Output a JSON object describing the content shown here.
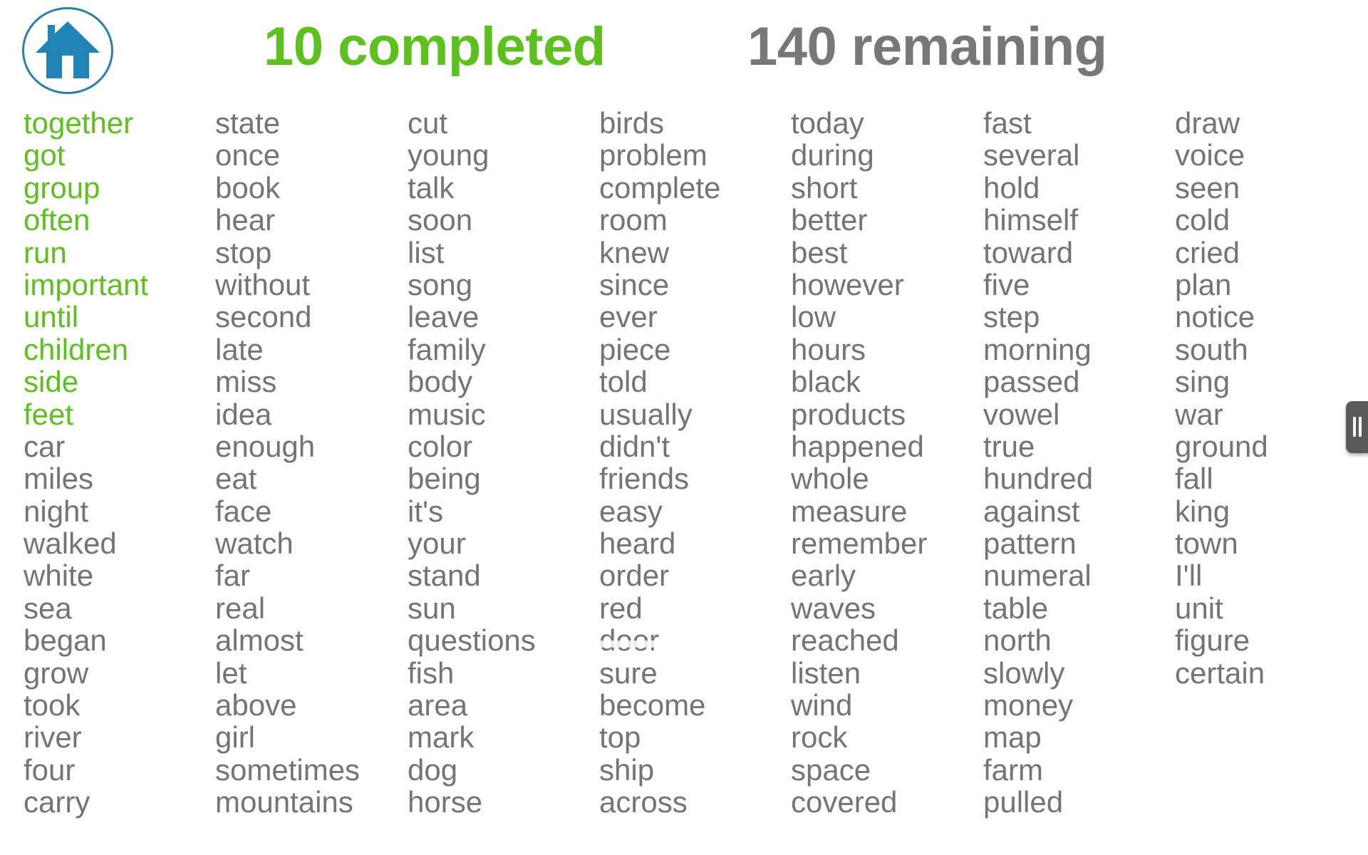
{
  "header": {
    "home_icon": "home-icon",
    "completed_label": "10 completed",
    "remaining_label": "140 remaining",
    "completed_count": 10,
    "remaining_count": 140
  },
  "colors": {
    "completed": "#5ec01f",
    "remaining": "#77777a",
    "word": "#747474",
    "home_icon": "#2b7ea9",
    "handle": "#5a5a5a"
  },
  "side_handle": {
    "icon": "drag-handle-icon"
  },
  "columns": [
    [
      {
        "text": "together",
        "done": true
      },
      {
        "text": "got",
        "done": true
      },
      {
        "text": "group",
        "done": true
      },
      {
        "text": "often",
        "done": true
      },
      {
        "text": "run",
        "done": true
      },
      {
        "text": "important",
        "done": true
      },
      {
        "text": "until",
        "done": true
      },
      {
        "text": "children",
        "done": true
      },
      {
        "text": "side",
        "done": true
      },
      {
        "text": "feet",
        "done": true
      },
      {
        "text": "car",
        "done": false
      },
      {
        "text": "miles",
        "done": false
      },
      {
        "text": "night",
        "done": false
      },
      {
        "text": "walked",
        "done": false
      },
      {
        "text": "white",
        "done": false
      },
      {
        "text": "sea",
        "done": false
      },
      {
        "text": "began",
        "done": false
      },
      {
        "text": "grow",
        "done": false
      },
      {
        "text": "took",
        "done": false
      },
      {
        "text": "river",
        "done": false
      },
      {
        "text": "four",
        "done": false
      },
      {
        "text": "carry",
        "done": false
      }
    ],
    [
      {
        "text": "state"
      },
      {
        "text": "once"
      },
      {
        "text": "book"
      },
      {
        "text": "hear"
      },
      {
        "text": "stop"
      },
      {
        "text": "without"
      },
      {
        "text": "second"
      },
      {
        "text": "late"
      },
      {
        "text": "miss"
      },
      {
        "text": "idea"
      },
      {
        "text": "enough"
      },
      {
        "text": "eat"
      },
      {
        "text": "face"
      },
      {
        "text": "watch"
      },
      {
        "text": "far"
      },
      {
        "text": "real"
      },
      {
        "text": "almost"
      },
      {
        "text": "let"
      },
      {
        "text": "above"
      },
      {
        "text": "girl"
      },
      {
        "text": "sometimes"
      },
      {
        "text": "mountains"
      }
    ],
    [
      {
        "text": "cut"
      },
      {
        "text": "young"
      },
      {
        "text": "talk"
      },
      {
        "text": "soon"
      },
      {
        "text": "list"
      },
      {
        "text": "song"
      },
      {
        "text": "leave"
      },
      {
        "text": "family"
      },
      {
        "text": "body"
      },
      {
        "text": "music"
      },
      {
        "text": "color"
      },
      {
        "text": "being"
      },
      {
        "text": "it's"
      },
      {
        "text": "your"
      },
      {
        "text": "stand"
      },
      {
        "text": "sun"
      },
      {
        "text": "questions"
      },
      {
        "text": "fish"
      },
      {
        "text": "area"
      },
      {
        "text": "mark"
      },
      {
        "text": "dog"
      },
      {
        "text": "horse"
      }
    ],
    [
      {
        "text": "birds"
      },
      {
        "text": "problem"
      },
      {
        "text": "complete"
      },
      {
        "text": "room"
      },
      {
        "text": "knew"
      },
      {
        "text": "since"
      },
      {
        "text": "ever"
      },
      {
        "text": "piece"
      },
      {
        "text": "told"
      },
      {
        "text": "usually"
      },
      {
        "text": "didn't"
      },
      {
        "text": "friends"
      },
      {
        "text": "easy"
      },
      {
        "text": "heard"
      },
      {
        "text": "order"
      },
      {
        "text": "red"
      },
      {
        "text": "door",
        "obscured": true
      },
      {
        "text": "sure"
      },
      {
        "text": "become"
      },
      {
        "text": "top"
      },
      {
        "text": "ship"
      },
      {
        "text": "across"
      }
    ],
    [
      {
        "text": "today"
      },
      {
        "text": "during"
      },
      {
        "text": "short"
      },
      {
        "text": "better"
      },
      {
        "text": "best"
      },
      {
        "text": "however"
      },
      {
        "text": "low"
      },
      {
        "text": "hours"
      },
      {
        "text": "black"
      },
      {
        "text": "products"
      },
      {
        "text": "happened"
      },
      {
        "text": "whole"
      },
      {
        "text": "measure"
      },
      {
        "text": "remember"
      },
      {
        "text": "early"
      },
      {
        "text": "waves"
      },
      {
        "text": "reached"
      },
      {
        "text": "listen"
      },
      {
        "text": "wind"
      },
      {
        "text": "rock"
      },
      {
        "text": "space"
      },
      {
        "text": "covered"
      }
    ],
    [
      {
        "text": "fast"
      },
      {
        "text": "several"
      },
      {
        "text": "hold"
      },
      {
        "text": "himself"
      },
      {
        "text": "toward"
      },
      {
        "text": "five"
      },
      {
        "text": "step"
      },
      {
        "text": "morning"
      },
      {
        "text": "passed"
      },
      {
        "text": "vowel"
      },
      {
        "text": "true"
      },
      {
        "text": "hundred"
      },
      {
        "text": "against"
      },
      {
        "text": "pattern"
      },
      {
        "text": "numeral"
      },
      {
        "text": "table"
      },
      {
        "text": "north"
      },
      {
        "text": "slowly"
      },
      {
        "text": "money"
      },
      {
        "text": "map"
      },
      {
        "text": "farm"
      },
      {
        "text": "pulled"
      }
    ],
    [
      {
        "text": "draw"
      },
      {
        "text": "voice"
      },
      {
        "text": "seen"
      },
      {
        "text": "cold"
      },
      {
        "text": "cried"
      },
      {
        "text": "plan"
      },
      {
        "text": "notice"
      },
      {
        "text": "south"
      },
      {
        "text": "sing"
      },
      {
        "text": "war"
      },
      {
        "text": "ground"
      },
      {
        "text": "fall"
      },
      {
        "text": "king"
      },
      {
        "text": "town"
      },
      {
        "text": "I'll"
      },
      {
        "text": "unit"
      },
      {
        "text": "figure"
      },
      {
        "text": "certain"
      }
    ]
  ]
}
